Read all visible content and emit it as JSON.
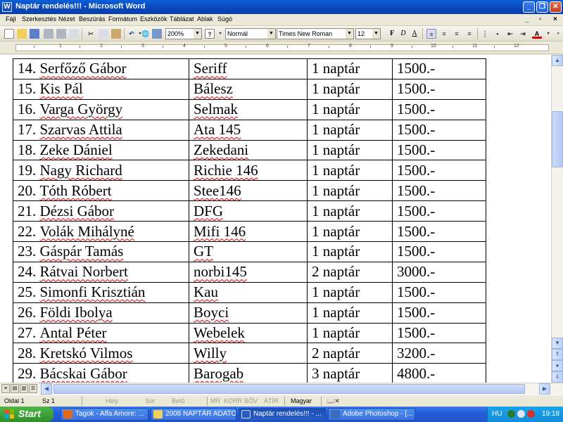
{
  "window": {
    "title": "Naptár rendelés!!! - Microsoft Word",
    "app_icon": "W"
  },
  "menu": [
    "Fájl",
    "Szerkesztés",
    "Nézet",
    "Beszúrás",
    "Formátum",
    "Eszközök",
    "Táblázat",
    "Ablak",
    "Súgó"
  ],
  "toolbar": {
    "zoom": "200%",
    "style": "Normál",
    "font": "Times New Roman",
    "font_size": "12",
    "bold": "F",
    "italic": "D",
    "underline": "A"
  },
  "ruler_marks": [
    "1",
    "2",
    "3",
    "4",
    "5",
    "6",
    "7",
    "8",
    "9",
    "10",
    "11",
    "12"
  ],
  "table": {
    "rows": [
      {
        "num": "14.",
        "name": "Serfőző Gábor",
        "nick": "Seriff",
        "qty": "1 naptár",
        "price": "1500.-"
      },
      {
        "num": "15.",
        "name": "Kis Pál",
        "nick": "Bálesz",
        "qty": "1 naptár",
        "price": "1500.-"
      },
      {
        "num": "16.",
        "name": "Varga György",
        "nick": "Selmak",
        "qty": "1 naptár",
        "price": "1500.-"
      },
      {
        "num": "17.",
        "name": "Szarvas Attila",
        "nick": "Ata 145",
        "qty": "1 naptár",
        "price": "1500.-"
      },
      {
        "num": "18.",
        "name": "Zeke Dániel",
        "nick": "Zekedani",
        "qty": "1 naptár",
        "price": "1500.-"
      },
      {
        "num": "19.",
        "name": "Nagy Richard",
        "nick": "Richie 146",
        "qty": "1 naptár",
        "price": "1500.-"
      },
      {
        "num": "20.",
        "name": "Tóth Róbert",
        "nick": "Stee146",
        "qty": "1 naptár",
        "price": "1500.-"
      },
      {
        "num": "21.",
        "name": "Dézsi Gábor",
        "nick": "DFG",
        "qty": "1 naptár",
        "price": "1500.-"
      },
      {
        "num": "22.",
        "name": "Volák Mihályné",
        "nick": "Mifi 146",
        "qty": "1 naptár",
        "price": "1500.-"
      },
      {
        "num": "23.",
        "name": "Gáspár Tamás",
        "nick": "GT",
        "qty": "1 naptár",
        "price": "1500.-"
      },
      {
        "num": "24.",
        "name": "Rátvai Norbert",
        "nick": "norbi145",
        "qty": "2 naptár",
        "price": "3000.-"
      },
      {
        "num": "25.",
        "name": "Simonfi Krisztián",
        "nick": "Kau",
        "qty": "1 naptár",
        "price": "1500.-"
      },
      {
        "num": "26.",
        "name": "Földi Ibolya",
        "nick": "Boyci",
        "qty": "1 naptár",
        "price": "1500.-"
      },
      {
        "num": "27.",
        "name": "Antal Péter",
        "nick": "Webelek",
        "qty": "1 naptár",
        "price": "1500.-"
      },
      {
        "num": "28.",
        "name": "Kretskó Vilmos",
        "nick": "Willy",
        "qty": "2 naptár",
        "price": "3200.-"
      },
      {
        "num": "29.",
        "name": "Bácskai Gábor",
        "nick": "Barogab",
        "qty": "3 naptár",
        "price": "4800.-"
      }
    ]
  },
  "status": {
    "page": "Oldal 1",
    "section": "Sz 1",
    "position": "Hely",
    "line": "Sor",
    "col": "Betű",
    "rec": "MR",
    "trk": "KORR",
    "ext": "BŐV",
    "ovr": "ÁTÍR",
    "lang": "Magyar"
  },
  "taskbar": {
    "start": "Start",
    "tasks": [
      {
        "label": "Tagok - Alfa Amore: ...",
        "icon": "firefox-icon",
        "color": "#e46a1a"
      },
      {
        "label": "2008 NAPTÁR ADATOK!",
        "icon": "folder-icon",
        "color": "#f2cf5a"
      },
      {
        "label": "Naptár rendelés!!! - ...",
        "icon": "word-icon",
        "color": "#2a5cc8"
      },
      {
        "label": "Adobe Photoshop - [...",
        "icon": "photoshop-icon",
        "color": "#3c6ab8"
      }
    ],
    "tray_lang": "HU",
    "clock": "19:18"
  }
}
